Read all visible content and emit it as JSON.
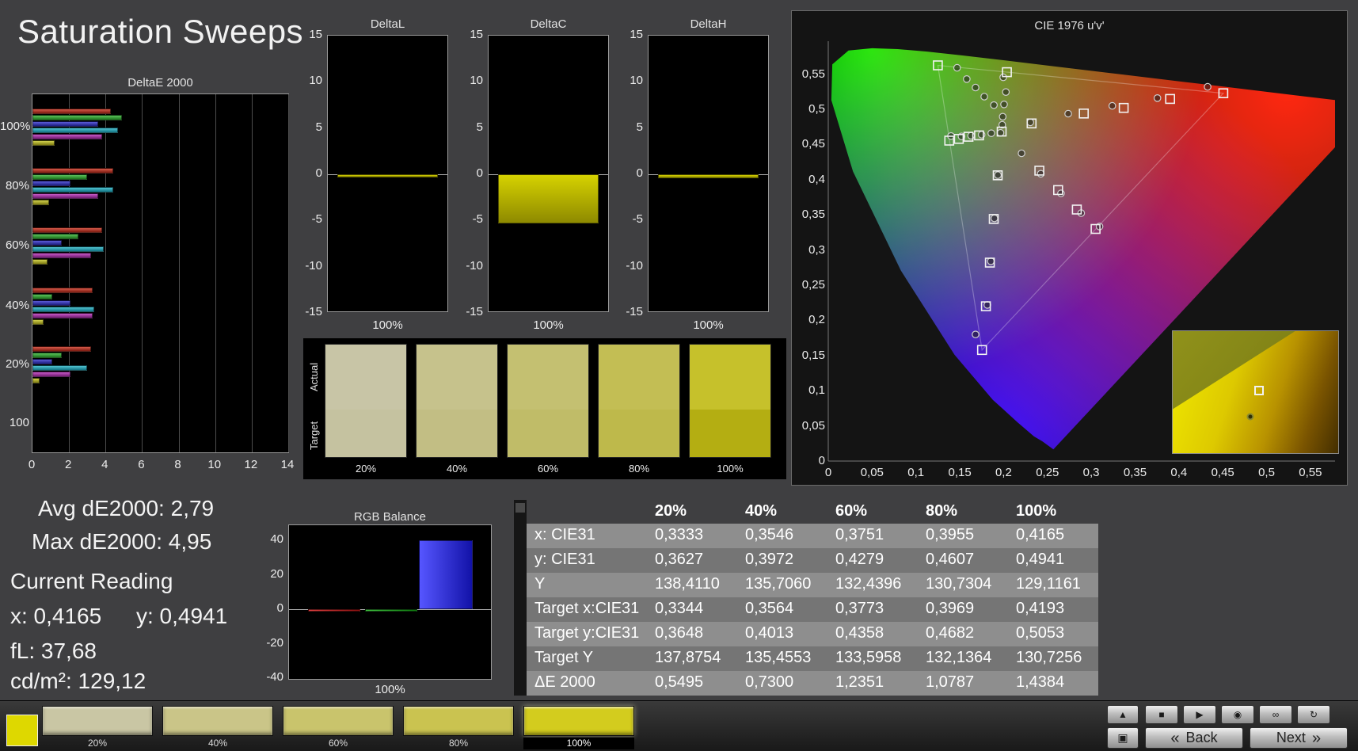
{
  "page": {
    "title": "Saturation Sweeps"
  },
  "delta_e": {
    "title": "DeltaE 2000",
    "x_ticks": [
      "0",
      "2",
      "4",
      "6",
      "8",
      "10",
      "12",
      "14"
    ],
    "x_max": 14,
    "y_labels": [
      "100%",
      "80%",
      "60%",
      "40%",
      "20%",
      "100"
    ],
    "series": [
      "red",
      "green",
      "blue",
      "cyan",
      "magenta",
      "yellow"
    ],
    "colors": {
      "red": [
        "#d65a4a",
        "#7e1b10"
      ],
      "green": [
        "#5cc25c",
        "#1c741c"
      ],
      "blue": [
        "#5c5cd8",
        "#1c1c80"
      ],
      "cyan": [
        "#52c4d2",
        "#127585"
      ],
      "magenta": [
        "#c85ac8",
        "#731b73"
      ],
      "yellow": [
        "#d2d24e",
        "#807c12"
      ]
    },
    "groups": [
      {
        "label": "100%",
        "values": [
          4.3,
          4.9,
          3.6,
          4.7,
          3.8,
          1.2
        ]
      },
      {
        "label": "80%",
        "values": [
          4.4,
          3.0,
          2.1,
          4.4,
          3.6,
          0.9
        ]
      },
      {
        "label": "60%",
        "values": [
          3.8,
          2.5,
          1.6,
          3.9,
          3.2,
          0.8
        ]
      },
      {
        "label": "40%",
        "values": [
          3.3,
          1.1,
          2.1,
          3.4,
          3.3,
          0.6
        ]
      },
      {
        "label": "20%",
        "values": [
          3.2,
          1.6,
          1.1,
          3.0,
          2.1,
          0.4
        ]
      },
      {
        "label": "100",
        "values": []
      }
    ]
  },
  "delta_lch": {
    "y_ticks": [
      15,
      10,
      5,
      0,
      -5,
      -10,
      -15
    ],
    "x_label": "100%",
    "bar_color": [
      "#d6d200",
      "#8e8a00"
    ],
    "charts": [
      {
        "title": "DeltaL",
        "value": -0.35
      },
      {
        "title": "DeltaC",
        "value": -5.3
      },
      {
        "title": "DeltaH",
        "value": -0.45
      }
    ]
  },
  "cie": {
    "title": "CIE 1976 u'v'",
    "x_ticks": [
      "0",
      "0,05",
      "0,1",
      "0,15",
      "0,2",
      "0,25",
      "0,3",
      "0,35",
      "0,4",
      "0,45",
      "0,5",
      "0,55"
    ],
    "y_ticks": [
      "0",
      "0,05",
      "0,1",
      "0,15",
      "0,2",
      "0,25",
      "0,3",
      "0,35",
      "0,4",
      "0,45",
      "0,5",
      "0,55"
    ],
    "targets": [
      [
        0.4507,
        0.5229
      ],
      [
        0.39,
        0.5147
      ],
      [
        0.337,
        0.502
      ],
      [
        0.2915,
        0.494
      ],
      [
        0.232,
        0.48
      ],
      [
        0.125,
        0.5625
      ],
      [
        0.2038,
        0.5528
      ],
      [
        0.138,
        0.4555
      ],
      [
        0.149,
        0.458
      ],
      [
        0.16,
        0.461
      ],
      [
        0.172,
        0.463
      ],
      [
        0.1978,
        0.4683
      ],
      [
        0.2408,
        0.4128
      ],
      [
        0.2622,
        0.3852
      ],
      [
        0.2836,
        0.3576
      ],
      [
        0.305,
        0.33
      ],
      [
        0.1933,
        0.4062
      ],
      [
        0.1888,
        0.3441
      ],
      [
        0.1844,
        0.2821
      ],
      [
        0.1799,
        0.22
      ],
      [
        0.1754,
        0.1579
      ]
    ],
    "measurements": [
      [
        0.4328,
        0.532
      ],
      [
        0.3755,
        0.516
      ],
      [
        0.324,
        0.505
      ],
      [
        0.2737,
        0.4938
      ],
      [
        0.2305,
        0.4815
      ],
      [
        0.147,
        0.559
      ],
      [
        0.158,
        0.543
      ],
      [
        0.168,
        0.531
      ],
      [
        0.178,
        0.518
      ],
      [
        0.189,
        0.506
      ],
      [
        0.1996,
        0.5455
      ],
      [
        0.2026,
        0.5246
      ],
      [
        0.2005,
        0.507
      ],
      [
        0.199,
        0.4895
      ],
      [
        0.1985,
        0.478
      ],
      [
        0.14,
        0.462
      ],
      [
        0.152,
        0.4615
      ],
      [
        0.163,
        0.4625
      ],
      [
        0.175,
        0.464
      ],
      [
        0.186,
        0.466
      ],
      [
        0.2205,
        0.4375
      ],
      [
        0.2425,
        0.4085
      ],
      [
        0.2655,
        0.3805
      ],
      [
        0.2885,
        0.3525
      ],
      [
        0.3095,
        0.3335
      ],
      [
        0.1935,
        0.4065
      ],
      [
        0.1895,
        0.345
      ],
      [
        0.1855,
        0.284
      ],
      [
        0.1815,
        0.222
      ],
      [
        0.168,
        0.18
      ],
      [
        0.1965,
        0.4665
      ]
    ],
    "inset": {
      "square_pos": [
        0.52,
        0.49
      ],
      "dot_pos": [
        0.47,
        0.7
      ]
    }
  },
  "swatch_panel": {
    "row_labels": [
      "Actual",
      "Target"
    ],
    "columns": [
      {
        "label": "20%",
        "actual": "#c8c5a6",
        "target": "#c5c2a0"
      },
      {
        "label": "40%",
        "actual": "#c6c28c",
        "target": "#c2be84"
      },
      {
        "label": "60%",
        "actual": "#c4c071",
        "target": "#c0bc68"
      },
      {
        "label": "80%",
        "actual": "#c3be54",
        "target": "#beb94b"
      },
      {
        "label": "100%",
        "actual": "#c6c12b",
        "target": "#b4ae12"
      }
    ]
  },
  "readings": {
    "avg": "Avg dE2000: 2,79",
    "max": "Max dE2000: 4,95",
    "current_title": "Current Reading",
    "x": "x: 0,4165",
    "y": "y: 0,4941",
    "fl": "fL: 37,68",
    "cdm2": "cd/m²: 129,12"
  },
  "rgb_balance": {
    "title": "RGB Balance",
    "y_ticks": [
      40,
      20,
      0,
      -20,
      -40
    ],
    "x_label": "100%",
    "bars": [
      {
        "name": "red",
        "value": -1.5,
        "colors": [
          "#e04040",
          "#8a1010"
        ]
      },
      {
        "name": "green",
        "value": -1.5,
        "colors": [
          "#40c040",
          "#0f7a0f"
        ]
      },
      {
        "name": "blue",
        "value": 40,
        "colors": [
          "#5656ff",
          "#1212a8"
        ]
      }
    ]
  },
  "table": {
    "headers": [
      "20%",
      "40%",
      "60%",
      "80%",
      "100%"
    ],
    "rows": [
      {
        "label": "x: CIE31",
        "values": [
          "0,3333",
          "0,3546",
          "0,3751",
          "0,3955",
          "0,4165"
        ]
      },
      {
        "label": "y: CIE31",
        "values": [
          "0,3627",
          "0,3972",
          "0,4279",
          "0,4607",
          "0,4941"
        ]
      },
      {
        "label": "Y",
        "values": [
          "138,4110",
          "135,7060",
          "132,4396",
          "130,7304",
          "129,1161"
        ]
      },
      {
        "label": "Target x:CIE31",
        "values": [
          "0,3344",
          "0,3564",
          "0,3773",
          "0,3969",
          "0,4193"
        ]
      },
      {
        "label": "Target y:CIE31",
        "values": [
          "0,3648",
          "0,4013",
          "0,4358",
          "0,4682",
          "0,5053"
        ]
      },
      {
        "label": "Target Y",
        "values": [
          "137,8754",
          "135,4553",
          "133,5958",
          "132,1364",
          "130,7256"
        ]
      },
      {
        "label": "ΔE 2000",
        "values": [
          "0,5495",
          "0,7300",
          "1,2351",
          "1,0787",
          "1,4384"
        ]
      }
    ]
  },
  "bottom_bar": {
    "current_color": "#ded800",
    "swatches": [
      {
        "label": "20%",
        "color": "#c9c6a4",
        "selected": false
      },
      {
        "label": "40%",
        "color": "#cac588",
        "selected": false
      },
      {
        "label": "60%",
        "color": "#c9c46c",
        "selected": false
      },
      {
        "label": "80%",
        "color": "#cac350",
        "selected": false
      },
      {
        "label": "100%",
        "color": "#d3cc1e",
        "selected": true
      }
    ],
    "controls_top": [
      {
        "name": "collapse",
        "glyph": "▲"
      },
      {
        "name": "stop",
        "glyph": "■"
      },
      {
        "name": "play",
        "glyph": "▶"
      },
      {
        "name": "record",
        "glyph": "◉"
      },
      {
        "name": "continuous",
        "glyph": "∞"
      },
      {
        "name": "refresh",
        "glyph": "↻"
      }
    ],
    "controls_bottom": [
      {
        "name": "stop-square",
        "glyph": "▣"
      }
    ],
    "back_glyph": "«",
    "back_label": "Back",
    "next_label": "Next",
    "next_glyph": "»"
  }
}
